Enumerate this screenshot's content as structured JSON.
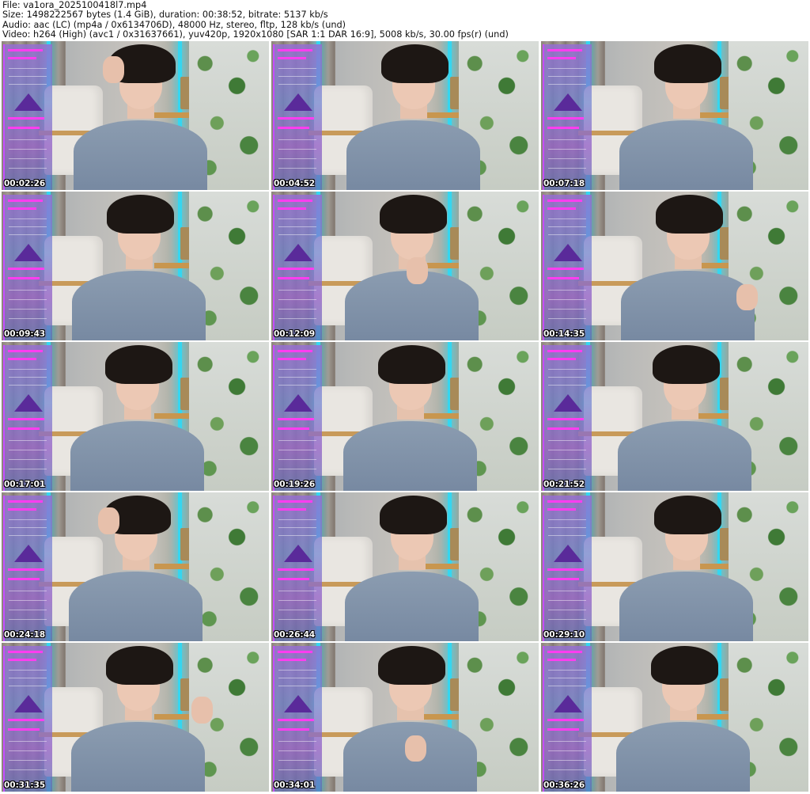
{
  "header": {
    "line1": "File: va1ora_2025100418l7.mp4",
    "line2": "Size: 1498222567 bytes (1.4 GiB), duration: 00:38:52, bitrate: 5137 kb/s",
    "line3": "Audio: aac (LC) (mp4a / 0x6134706D), 48000 Hz, stereo, fltp, 128 kb/s (und)",
    "line4": "Video: h264 (High) (avc1 / 0x31637661), yuv420p, 1920x1080 [SAR 1:1 DAR 16:9], 5008 kb/s, 30.00 fps(r) (und)"
  },
  "thumbnails": [
    {
      "timestamp": "00:02:26"
    },
    {
      "timestamp": "00:04:52"
    },
    {
      "timestamp": "00:07:18"
    },
    {
      "timestamp": "00:09:43"
    },
    {
      "timestamp": "00:12:09"
    },
    {
      "timestamp": "00:14:35"
    },
    {
      "timestamp": "00:17:01"
    },
    {
      "timestamp": "00:19:26"
    },
    {
      "timestamp": "00:21:52"
    },
    {
      "timestamp": "00:24:18"
    },
    {
      "timestamp": "00:26:44"
    },
    {
      "timestamp": "00:29:10"
    },
    {
      "timestamp": "00:31:35"
    },
    {
      "timestamp": "00:34:01"
    },
    {
      "timestamp": "00:36:26"
    }
  ]
}
